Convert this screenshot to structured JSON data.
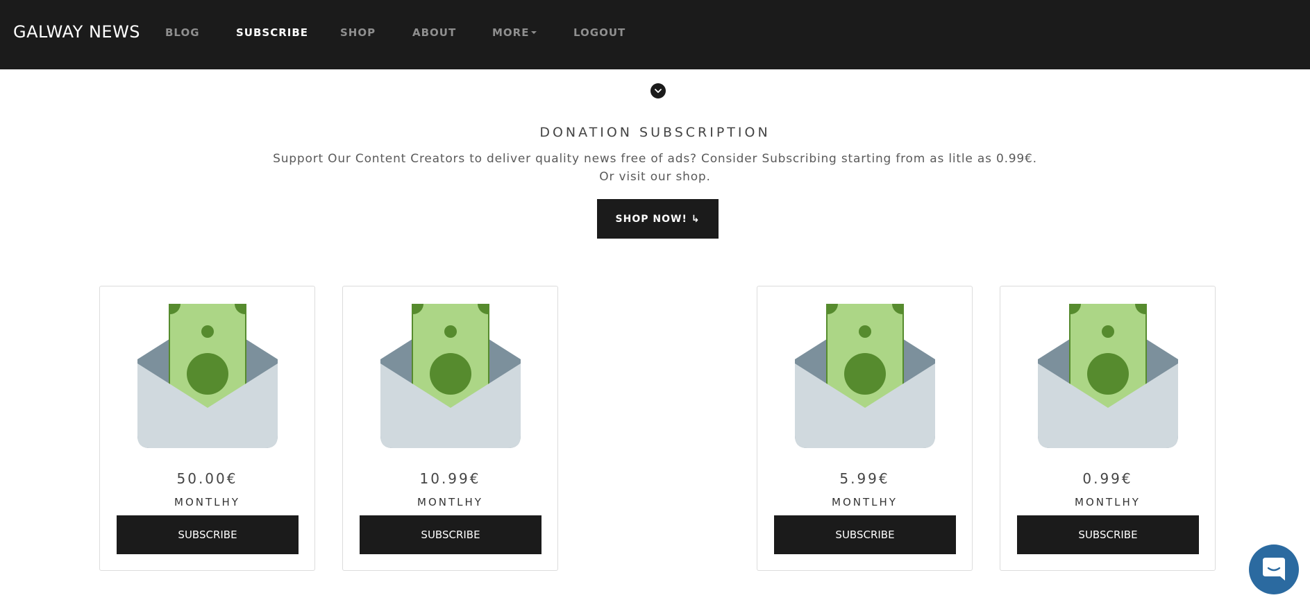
{
  "navbar": {
    "brand": "GALWAY NEWS",
    "items": [
      {
        "label": "BLOG",
        "active": false
      },
      {
        "label": "SUBSCRIBE",
        "active": true
      },
      {
        "label": "SHOP",
        "active": false
      },
      {
        "label": "ABOUT",
        "active": false
      },
      {
        "label": "MORE",
        "active": false,
        "dropdown": true
      },
      {
        "label": "LOGOUT",
        "active": false
      }
    ]
  },
  "hero": {
    "title": "DONATION SUBSCRIPTION",
    "line1": "Support Our Content Creators to deliver quality news free of ads? Consider Subscribing starting from as litle as 0.99€.",
    "line2": "Or visit our shop.",
    "shop_button": "SHOP NOW! ↳"
  },
  "plans": [
    {
      "price": "50.00€",
      "period": "MONTLHY",
      "button": "SUBSCRIBE"
    },
    {
      "price": "10.99€",
      "period": "MONTLHY",
      "button": "SUBSCRIBE"
    },
    {
      "price": "5.99€",
      "period": "MONTLHY",
      "button": "SUBSCRIBE"
    },
    {
      "price": "0.99€",
      "period": "MONTLHY",
      "button": "SUBSCRIBE"
    }
  ],
  "icons": {
    "scroll": "chevron-down-icon",
    "plan_image": "money-envelope-icon",
    "chat": "chat-icon"
  },
  "colors": {
    "navbar_bg": "#1b1b1b",
    "button_bg": "#1b1b1b",
    "chat_bg": "#2b6aa0",
    "bill_dark": "#568b2e",
    "bill_light": "#acd686",
    "envelope_back": "#7c909c",
    "envelope_front": "#d0d9de"
  }
}
